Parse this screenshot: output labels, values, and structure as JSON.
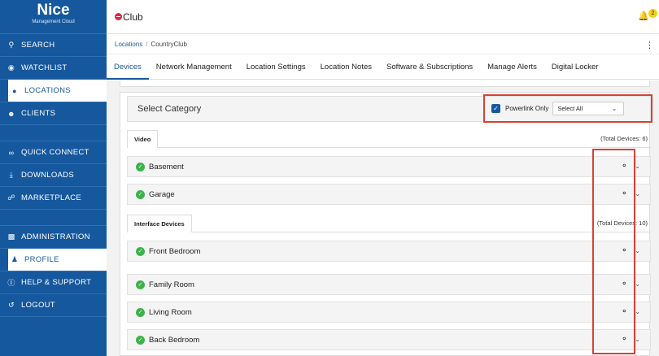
{
  "sidebar": {
    "brand": "Nice",
    "brand_sub": "Management Cloud",
    "items": [
      {
        "label": "SEARCH",
        "icon": "search-icon"
      },
      {
        "label": "WATCHLIST",
        "icon": "eye-icon"
      },
      {
        "label": "LOCATIONS",
        "icon": "location-pin-icon",
        "active": true
      },
      {
        "label": "CLIENTS",
        "icon": "people-icon"
      },
      {
        "label": "QUICK CONNECT",
        "icon": "link-icon"
      },
      {
        "label": "DOWNLOADS",
        "icon": "download-icon"
      },
      {
        "label": "MARKETPLACE",
        "icon": "cart-icon"
      },
      {
        "label": "ADMINISTRATION",
        "icon": "bar-chart-icon"
      },
      {
        "label": "PROFILE",
        "icon": "person-icon"
      },
      {
        "label": "HELP & SUPPORT",
        "icon": "help-icon"
      },
      {
        "label": "LOGOUT",
        "icon": "logout-icon"
      }
    ]
  },
  "header": {
    "title": "Club",
    "notification_count": "2"
  },
  "breadcrumb": {
    "root": "Locations",
    "separator": "/",
    "current": "CountryClub"
  },
  "tabs": [
    "Devices",
    "Network Management",
    "Location Settings",
    "Location Notes",
    "Software & Subscriptions",
    "Manage Alerts",
    "Digital Locker"
  ],
  "category": {
    "title": "Select Category",
    "powerlink_label": "Powerlink Only",
    "powerlink_checked": true,
    "select_value": "Select All"
  },
  "sections": [
    {
      "name": "Video",
      "total": "(Total Devices: 6)",
      "devices": [
        "Basement",
        "Garage"
      ]
    },
    {
      "name": "Interface Devices",
      "total": "(Total Devices: 10)",
      "devices": [
        "Front Bedroom",
        "Family Room",
        "Living Room",
        "Back Bedroom"
      ]
    }
  ],
  "colors": {
    "sidebar": "#16589e",
    "highlight": "#d94032",
    "status_ok": "#3bb34a",
    "brand_red": "#e0263f"
  }
}
